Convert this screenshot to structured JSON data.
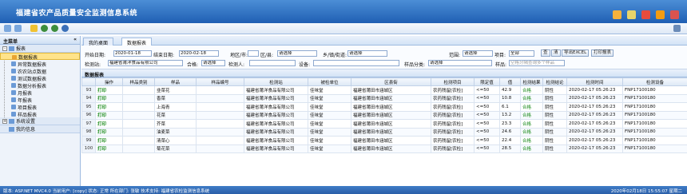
{
  "app": {
    "title": "福建省农产品质量安全监测信息系统"
  },
  "sidebar": {
    "header": "主菜单",
    "collapse": "«",
    "group": "报表",
    "items": [
      {
        "label": "数据报表"
      },
      {
        "label": "异常数据报表"
      },
      {
        "label": "农农站点数据"
      },
      {
        "label": "测试数据报表"
      },
      {
        "label": "数据分析报表"
      },
      {
        "label": "月报表"
      },
      {
        "label": "年报表"
      },
      {
        "label": "项目报表"
      },
      {
        "label": "样品报表"
      }
    ],
    "group2": "系统设置",
    "group3": "我的信息"
  },
  "tabs": [
    {
      "label": "我的桌面"
    },
    {
      "label": "数据报表"
    }
  ],
  "filters": {
    "start_label": "开始日期:",
    "start_value": "2020-01-18",
    "end_label": "结束日期:",
    "end_value": "2020-02-18",
    "region_label": "地区/市:",
    "county_label": "区/县:",
    "county_value": "请选择",
    "town_label": "乡/镇/街道:",
    "town_value": "请选择",
    "scope_label": "范围:",
    "scope_value": "请选择",
    "item_label": "项目:",
    "item_value": "全部",
    "btn_query": "查",
    "btn_clear": "清",
    "btn_export": "导出EXCEL",
    "btn_print": "打印报表",
    "station_label": "检测站:",
    "station_value": "福建省莆洋食品有限公司",
    "pass_label": "合格:",
    "pass_value": "请选择",
    "tester_label": "检测人:",
    "device_label": "设备:",
    "category_label": "样品分类:",
    "category_value": "请选择",
    "sample_label": "样品:",
    "sample_placeholder": "空格分隔查询多个样品"
  },
  "grid": {
    "title": "数据报表",
    "columns": [
      "",
      "操作",
      "样品类别",
      "样品",
      "样品编号",
      "检测站",
      "被检单位",
      "区县街",
      "检测项目",
      "限定值",
      "值",
      "检测结果",
      "检测结论",
      "检测时间",
      "检测设备"
    ],
    "rows": [
      [
        "93",
        "打印",
        "",
        "韭菜花",
        "",
        "福建省莆洋食品有限公司",
        "佳味堂",
        "福建省莆田市涵城区",
        "农药残留[农检]",
        "<=50",
        "42.9",
        "合格",
        "阴性",
        "2020-02-17 05:26:23",
        "FNP17100180"
      ],
      [
        "94",
        "打印",
        "",
        "香菜",
        "",
        "福建省莆洋食品有限公司",
        "佳味堂",
        "福建省莆田市涵城区",
        "农药残留[农检]",
        "<=50",
        "10.8",
        "合格",
        "阴性",
        "2020-02-17 05:26:23",
        "FNP17100180"
      ],
      [
        "95",
        "打印",
        "",
        "上海青",
        "",
        "福建省莆洋食品有限公司",
        "佳味堂",
        "福建省莆田市涵城区",
        "农药残留[农检]",
        "<=50",
        "6.1",
        "合格",
        "阴性",
        "2020-02-17 05:26:23",
        "FNP17100180"
      ],
      [
        "96",
        "打印",
        "",
        "花菜",
        "",
        "福建省莆洋食品有限公司",
        "佳味堂",
        "福建省莆田市涵城区",
        "农药残留[农检]",
        "<=50",
        "13.2",
        "合格",
        "阴性",
        "2020-02-17 05:26:23",
        "FNP17100180"
      ],
      [
        "97",
        "打印",
        "",
        "芥菜",
        "",
        "福建省莆洋食品有限公司",
        "佳味堂",
        "福建省莆田市涵城区",
        "农药残留[农检]",
        "<=50",
        "23.3",
        "合格",
        "阴性",
        "2020-02-17 05:26:23",
        "FNP17100180"
      ],
      [
        "98",
        "打印",
        "",
        "油麦菜",
        "",
        "福建省莆洋食品有限公司",
        "佳味堂",
        "福建省莆田市涵城区",
        "农药残留[农检]",
        "<=50",
        "24.6",
        "合格",
        "阴性",
        "2020-02-17 05:26:23",
        "FNP17100180"
      ],
      [
        "99",
        "打印",
        "",
        "清菜心",
        "",
        "福建省莆洋食品有限公司",
        "佳味堂",
        "福建省莆田市涵城区",
        "农药残留[农检]",
        "<=50",
        "22.4",
        "合格",
        "阴性",
        "2020-02-17 05:26:23",
        "FNP17100180"
      ],
      [
        "100",
        "打印",
        "",
        "菊花菜",
        "",
        "福建省莆洋食品有限公司",
        "佳味堂",
        "福建省莆田市涵城区",
        "农药残留[农检]",
        "<=50",
        "28.5",
        "合格",
        "阴性",
        "2020-02-17 05:26:23",
        "FNP17100180"
      ]
    ]
  },
  "status": {
    "left": "版本: ASP.NET MVC4.0 当前用户: [copy] 状态: 正常 所在部门: 张敏 技术支持: 福建省农检监测信息系统",
    "right": "2020年02月18日 15:55:07 星期二"
  }
}
